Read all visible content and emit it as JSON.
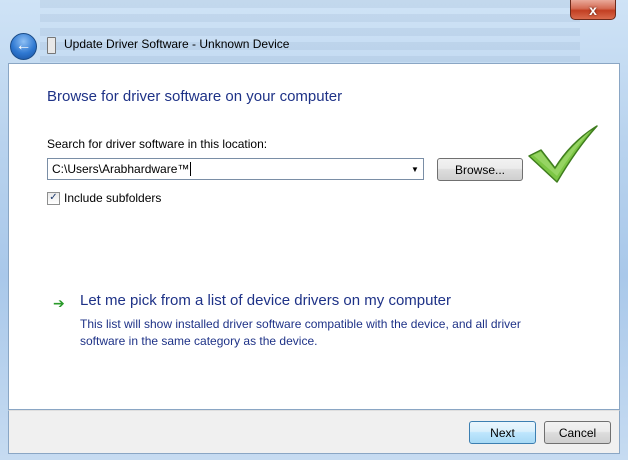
{
  "window": {
    "title": "Update Driver Software - Unknown Device",
    "close_glyph": "x"
  },
  "back_button": {
    "glyph": "←",
    "icon": "back-arrow-icon"
  },
  "main": {
    "heading": "Browse for driver software on your computer",
    "location_label": "Search for driver software in this location:",
    "location_value": "C:\\Users\\Arabhardware™",
    "browse_label": "Browse...",
    "include_subfolders_label": "Include subfolders",
    "include_subfolders_checked": true,
    "pick_link_title": "Let me pick from a list of device drivers on my computer",
    "pick_link_description": "This list will show installed driver software compatible with the device, and all driver software in the same category as the device."
  },
  "footer": {
    "next_label": "Next",
    "cancel_label": "Cancel"
  },
  "colors": {
    "heading_blue": "#1e3287",
    "link_arrow_green": "#2a9a2a",
    "checkmark_green": "#6fbf3a"
  }
}
